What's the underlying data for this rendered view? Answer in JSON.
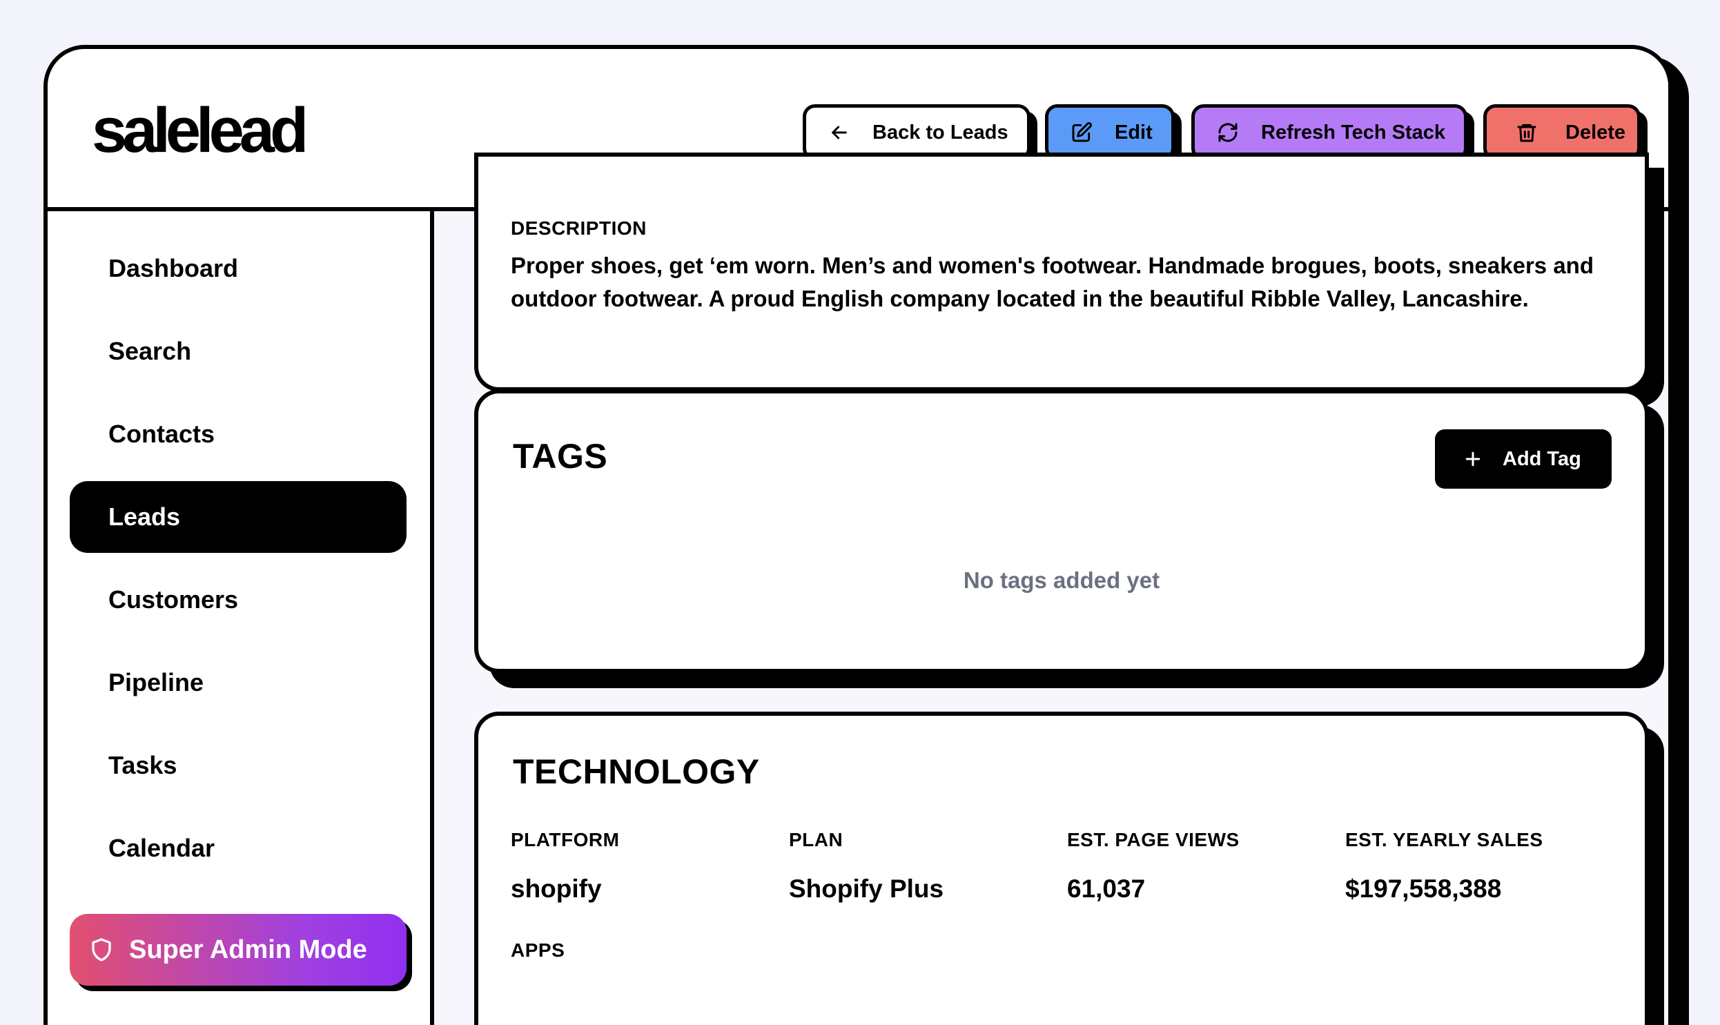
{
  "app": {
    "logo": "salelead"
  },
  "toolbar": {
    "back_label": "Back to Leads",
    "edit_label": "Edit",
    "refresh_label": "Refresh Tech Stack",
    "delete_label": "Delete"
  },
  "sidebar": {
    "items": [
      {
        "label": "Dashboard"
      },
      {
        "label": "Search"
      },
      {
        "label": "Contacts"
      },
      {
        "label": "Leads",
        "active": true
      },
      {
        "label": "Customers"
      },
      {
        "label": "Pipeline"
      },
      {
        "label": "Tasks"
      },
      {
        "label": "Calendar"
      }
    ],
    "super_admin_label": "Super Admin Mode"
  },
  "description": {
    "label": "DESCRIPTION",
    "text": "Proper shoes, get ‘em worn. Men’s and women's footwear. Handmade brogues, boots, sneakers and outdoor footwear. A proud English company located in the beautiful Ribble Valley, Lancashire."
  },
  "tags": {
    "title": "TAGS",
    "add_label": "Add Tag",
    "empty_text": "No tags added yet"
  },
  "technology": {
    "title": "TECHNOLOGY",
    "fields": [
      {
        "label": "PLATFORM",
        "value": "shopify"
      },
      {
        "label": "PLAN",
        "value": "Shopify Plus"
      },
      {
        "label": "EST. PAGE VIEWS",
        "value": "61,037"
      },
      {
        "label": "EST. YEARLY SALES",
        "value": "$197,558,388"
      }
    ],
    "apps_label": "APPS"
  },
  "colors": {
    "edit": "#5b9bf7",
    "refresh": "#b57af5",
    "delete": "#f0706a",
    "empty_text": "#6b7080"
  }
}
